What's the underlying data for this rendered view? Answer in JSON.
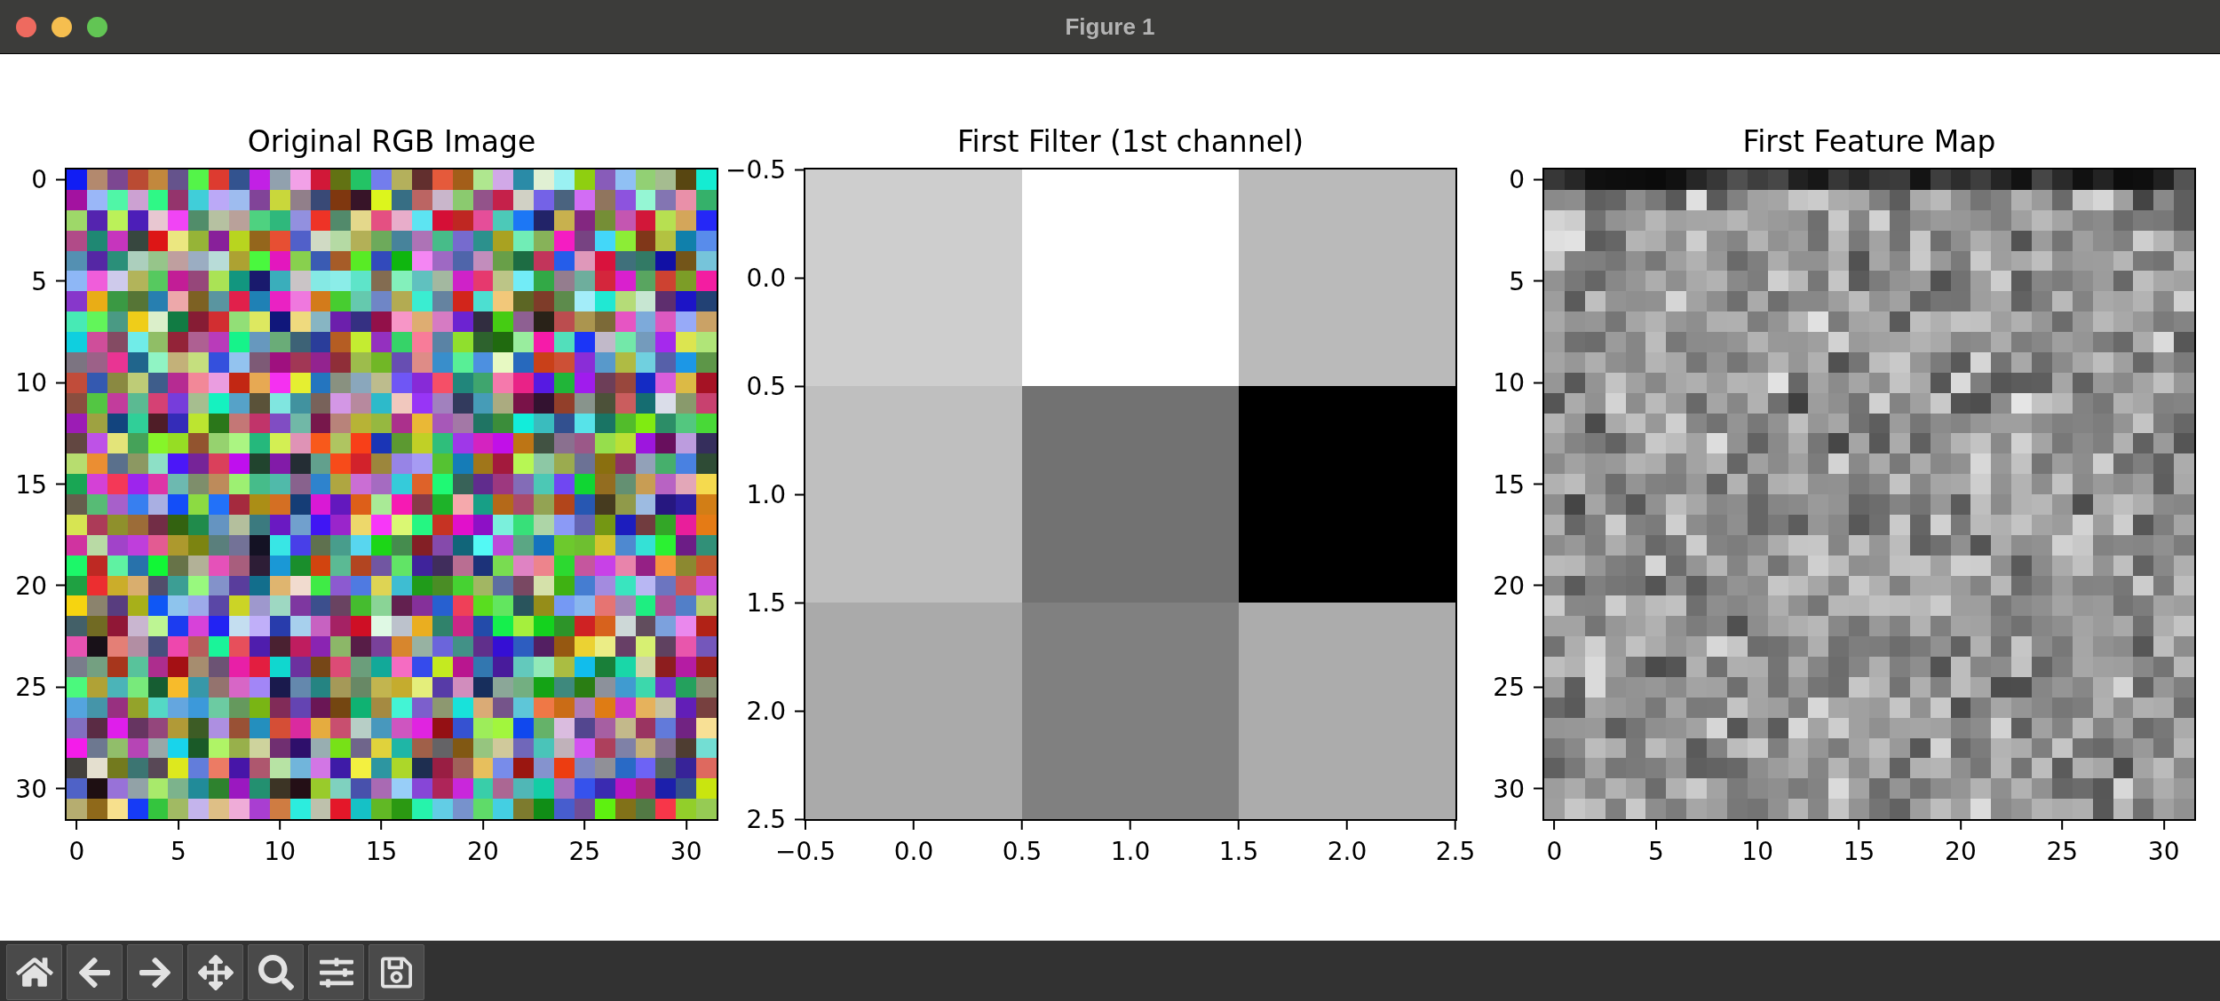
{
  "window": {
    "title": "Figure 1"
  },
  "plots": [
    {
      "kind": "rgb-image",
      "title": "Original RGB Image",
      "yticks": [
        "0",
        "5",
        "10",
        "15",
        "20",
        "25",
        "30"
      ],
      "xticks": [
        "0",
        "5",
        "10",
        "15",
        "20",
        "25",
        "30"
      ]
    },
    {
      "kind": "filter-heatmap",
      "title": "First Filter (1st channel)",
      "yticks": [
        "−0.5",
        "0.0",
        "0.5",
        "1.0",
        "1.5",
        "2.0",
        "2.5"
      ],
      "xticks": [
        "−0.5",
        "0.0",
        "0.5",
        "1.0",
        "1.5",
        "2.0",
        "2.5"
      ],
      "cells": [
        {
          "color": "#cecece"
        },
        {
          "color": "#ffffff"
        },
        {
          "color": "#bababa"
        },
        {
          "color": "#bfbfbf"
        },
        {
          "color": "#727272"
        },
        {
          "color": "#000000"
        },
        {
          "color": "#aaaaaa"
        },
        {
          "color": "#808080"
        },
        {
          "color": "#acacac"
        }
      ]
    },
    {
      "kind": "feature-map",
      "title": "First Feature Map",
      "yticks": [
        "0",
        "5",
        "10",
        "15",
        "20",
        "25",
        "30"
      ],
      "xticks": [
        "0",
        "5",
        "10",
        "15",
        "20",
        "25",
        "30"
      ]
    }
  ]
}
